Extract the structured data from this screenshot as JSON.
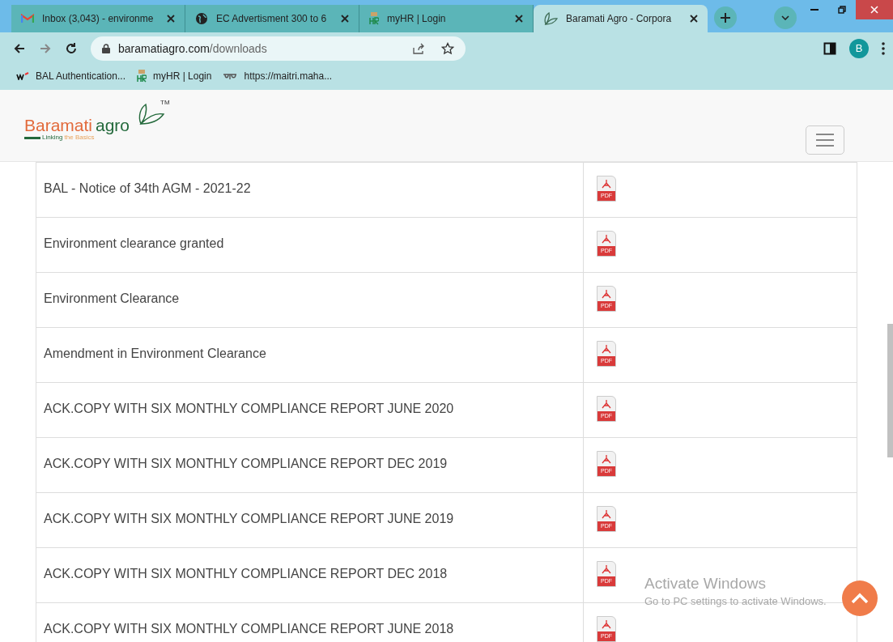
{
  "tabs": [
    {
      "title": "Inbox (3,043) - environme",
      "selected": false
    },
    {
      "title": "EC Advertisment 300 to 6",
      "selected": false
    },
    {
      "title": "myHR | Login",
      "selected": false
    },
    {
      "title": "Baramati Agro - Corpora",
      "selected": true
    }
  ],
  "address": {
    "domain": "baramatiagro.com",
    "path": "/downloads"
  },
  "profile": "B",
  "bookmarks": [
    {
      "label": "BAL Authentication..."
    },
    {
      "label": "myHR | Login"
    },
    {
      "label": "https://maitri.maha..."
    }
  ],
  "site": {
    "logo_name": "Baramati",
    "logo_agro": "agro",
    "tm": "TM",
    "tagline_a": "Linking",
    "tagline_b": "the Basics"
  },
  "downloads": [
    {
      "title": "BAL - Notice of 34th AGM - 2021-22",
      "file": "PDF"
    },
    {
      "title": "Environment clearance granted",
      "file": "PDF"
    },
    {
      "title": "Environment Clearance",
      "file": "PDF"
    },
    {
      "title": "Amendment in Environment Clearance",
      "file": "PDF"
    },
    {
      "title": "ACK.COPY WITH SIX MONTHLY COMPLIANCE REPORT JUNE 2020",
      "file": "PDF"
    },
    {
      "title": "ACK.COPY WITH SIX MONTHLY COMPLIANCE REPORT DEC 2019",
      "file": "PDF"
    },
    {
      "title": "ACK.COPY WITH SIX MONTHLY COMPLIANCE REPORT JUNE 2019",
      "file": "PDF"
    },
    {
      "title": "ACK.COPY WITH SIX MONTHLY COMPLIANCE REPORT DEC 2018",
      "file": "PDF"
    },
    {
      "title": "ACK.COPY WITH SIX MONTHLY COMPLIANCE REPORT JUNE 2018",
      "file": "PDF"
    }
  ],
  "activation": {
    "title": "Activate Windows",
    "subtitle": "Go to PC settings to activate Windows."
  }
}
